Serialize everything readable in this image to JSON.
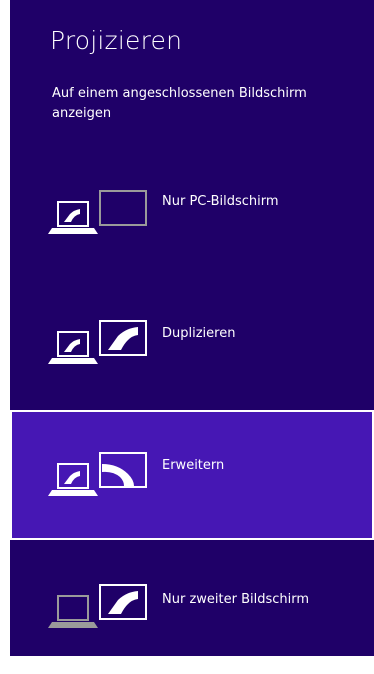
{
  "panel": {
    "title": "Projizieren",
    "subtitle": "Auf einem angeschlossenen Bildschirm anzeigen"
  },
  "options": [
    {
      "label": "Nur PC-Bildschirm",
      "selected": false,
      "icon": "pc-screen-only-icon"
    },
    {
      "label": "Duplizieren",
      "selected": false,
      "icon": "duplicate-icon"
    },
    {
      "label": "Erweitern",
      "selected": true,
      "icon": "extend-icon"
    },
    {
      "label": "Nur zweiter Bildschirm",
      "selected": false,
      "icon": "second-screen-only-icon"
    }
  ],
  "colors": {
    "panel_background": "#1f0068",
    "selected_background": "#4617b4",
    "icon_inactive": "#9a9a9a",
    "foreground": "#ffffff"
  }
}
